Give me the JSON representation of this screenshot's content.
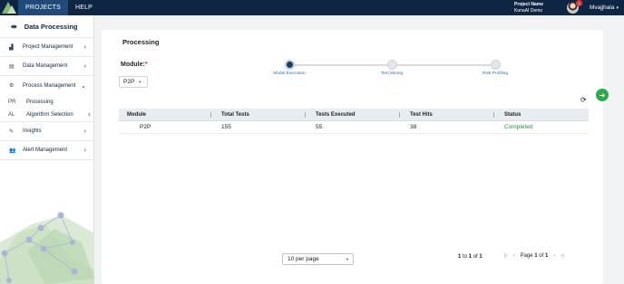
{
  "topbar": {
    "tabs": [
      {
        "label": "PROJECTS",
        "active": true
      },
      {
        "label": "HELP",
        "active": false
      }
    ],
    "project_label": "Project Name",
    "project_value": "KonaAI Demo",
    "user_name": "Mvajjhala",
    "notification_count": "1"
  },
  "sidebar": {
    "title": "Data Processing",
    "items": [
      {
        "label": "Project Management",
        "icon": "hierarchy-icon"
      },
      {
        "label": "Data Management",
        "icon": "database-icon"
      },
      {
        "label": "Process Management",
        "icon": "gears-icon",
        "expanded": true
      },
      {
        "label": "Insights",
        "icon": "edit-icon"
      },
      {
        "label": "Alert Management",
        "icon": "users-icon"
      }
    ],
    "sub_items": [
      {
        "abbr": "PR",
        "label": "Processing"
      },
      {
        "abbr": "AL",
        "label": "Algorithm Selection"
      }
    ]
  },
  "main": {
    "title": "Processing",
    "module_label": "Module:",
    "module_required": "*",
    "module_value": "P2P",
    "steps": [
      {
        "label": "Model Execution",
        "active": true
      },
      {
        "label": "Text Mining",
        "active": false
      },
      {
        "label": "Risk Profiling",
        "active": false
      }
    ],
    "table": {
      "headers": [
        "Module",
        "Total Tests",
        "Tests Executed",
        "Test Hits",
        "Status"
      ],
      "rows": [
        [
          "P2P",
          "155",
          "55",
          "38",
          "Completed"
        ]
      ]
    },
    "footer": {
      "per_page": "10 per page",
      "range_from": "1",
      "range_to": "1",
      "range_total": "1",
      "page_current": "1",
      "page_total": "1"
    }
  },
  "colors": {
    "navbar": "#0e2644",
    "active_tab": "#1f4a7a",
    "status_completed": "#2e8b3d",
    "step_link": "#2d6fb8",
    "fab": "#2fa84f"
  }
}
